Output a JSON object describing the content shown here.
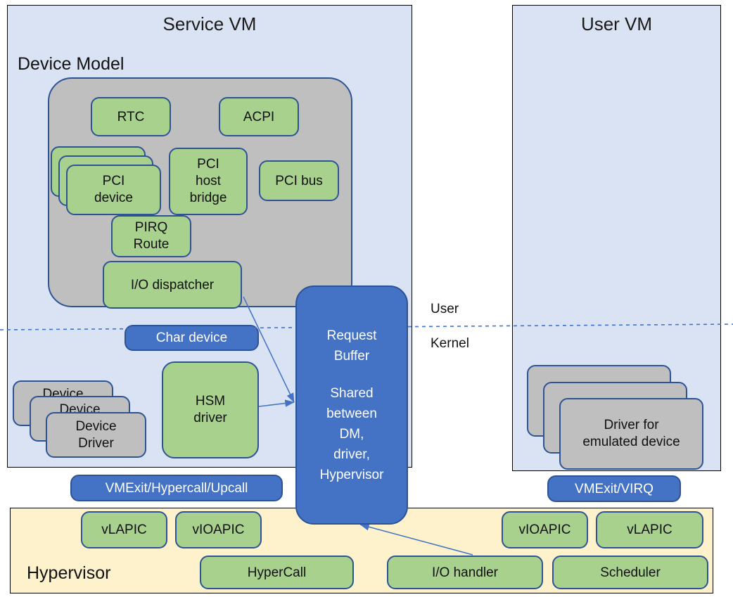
{
  "colors": {
    "vm_background": "#dae3f3",
    "hypervisor_background": "#fdf2cc",
    "green_component": "#a9d18e",
    "gray_component": "#bfbfbf",
    "blue_component": "#4472c4",
    "border": "#2e5395",
    "outline": "#000000",
    "connector": "#4472c4"
  },
  "service_vm": {
    "title": "Service VM",
    "device_model": {
      "heading": "Device Model",
      "components": [
        {
          "label": "RTC"
        },
        {
          "label": "ACPI"
        },
        {
          "label": "PCI\ndevice",
          "stacked": true
        },
        {
          "label": "PCI\nhost\nbridge"
        },
        {
          "label": "PCI bus"
        },
        {
          "label": "PIRQ\nRoute"
        },
        {
          "label": "I/O dispatcher"
        }
      ]
    },
    "char_device": "Char device",
    "hsm_driver": "HSM\ndriver",
    "device_driver": "Device\nDriver",
    "device_driver_stack_count": 3,
    "vmexit_label": "VMExit/Hypercall/Upcall"
  },
  "user_vm": {
    "title": "User VM",
    "driver": "Driver for\nemulated device",
    "driver_stack_count": 3,
    "vmexit_label": "VMExit/VIRQ"
  },
  "request_buffer": {
    "line1": "Request",
    "line2": "Buffer",
    "line3": "Shared",
    "line4": "between",
    "line5": "DM,",
    "line6": "driver,",
    "line7": "Hypervisor"
  },
  "privilege": {
    "user_label": "User",
    "kernel_label": "Kernel"
  },
  "hypervisor": {
    "heading": "Hypervisor",
    "components": [
      {
        "label": "vLAPIC"
      },
      {
        "label": "vIOAPIC"
      },
      {
        "label": "vIOAPIC"
      },
      {
        "label": "vLAPIC"
      },
      {
        "label": "HyperCall"
      },
      {
        "label": "I/O handler"
      },
      {
        "label": "Scheduler"
      }
    ]
  },
  "connectors": [
    {
      "from": "io-dispatcher",
      "to": "request-buffer"
    },
    {
      "from": "hsm-driver",
      "to": "request-buffer"
    },
    {
      "from": "io-handler",
      "to": "request-buffer"
    }
  ]
}
